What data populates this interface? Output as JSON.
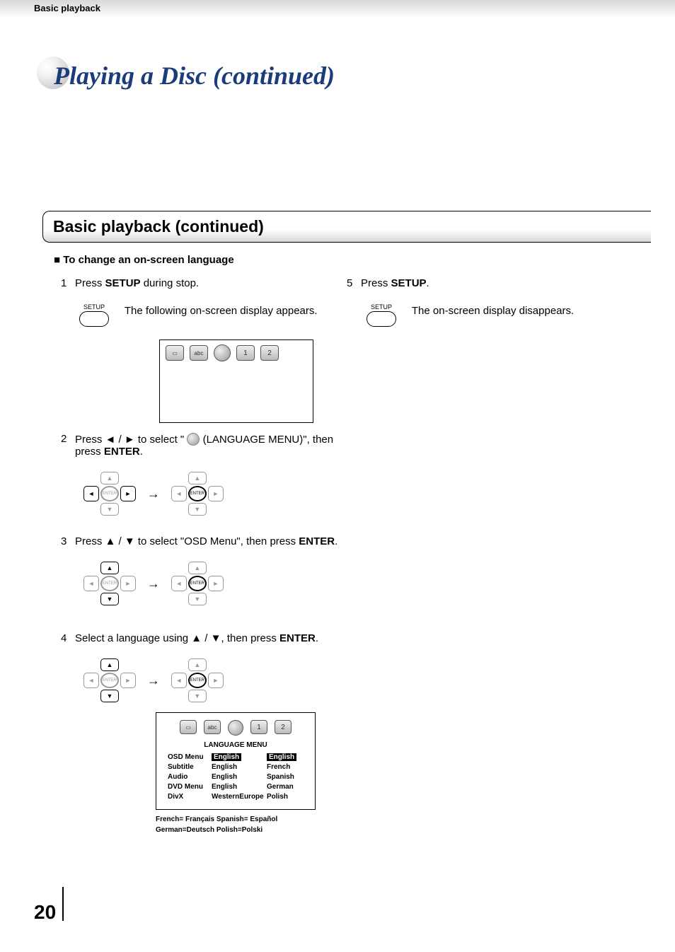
{
  "breadcrumb": "Basic playback",
  "hero_title": "Playing a Disc (continued)",
  "section_title": "Basic playback (continued)",
  "sub_heading": "To change an on-screen language",
  "setup_label": "SETUP",
  "steps": {
    "s1": {
      "num": "1",
      "text_a": "Press ",
      "text_b": "SETUP",
      "text_c": " during stop.",
      "caption": "The following on-screen display appears."
    },
    "s2": {
      "num": "2",
      "text_a": "Press ◄ / ► to select \"",
      "text_b": " (LANGUAGE MENU)\", then press ",
      "text_c": "ENTER",
      "text_d": "."
    },
    "s3": {
      "num": "3",
      "text_a": "Press ▲ / ▼ to select \"OSD Menu\", then press ",
      "text_b": "ENTER",
      "text_c": "."
    },
    "s4": {
      "num": "4",
      "text_a": "Select a language using ▲ / ▼, then press ",
      "text_b": "ENTER",
      "text_c": "."
    },
    "s5": {
      "num": "5",
      "text_a": "Press ",
      "text_b": "SETUP",
      "text_c": ".",
      "caption": "The on-screen display disappears."
    }
  },
  "enter_label": "ENTER",
  "osd_icons": {
    "func1": "1",
    "func2": "2",
    "abc": "abc"
  },
  "lang_menu": {
    "title": "LANGUAGE MENU",
    "rows": [
      {
        "label": "OSD Menu",
        "val": "English",
        "opt": "English",
        "hilite_val": true,
        "hilite_opt": true
      },
      {
        "label": "Subtitle",
        "val": "English",
        "opt": "French"
      },
      {
        "label": "Audio",
        "val": "English",
        "opt": "Spanish"
      },
      {
        "label": "DVD Menu",
        "val": "English",
        "opt": "German"
      },
      {
        "label": "DivX",
        "val": "WesternEurope",
        "opt": "Polish"
      }
    ]
  },
  "footnote": {
    "line1": "French= Français   Spanish= Español",
    "line2": "German=Deutsch   Polish=Polski"
  },
  "page_number": "20"
}
